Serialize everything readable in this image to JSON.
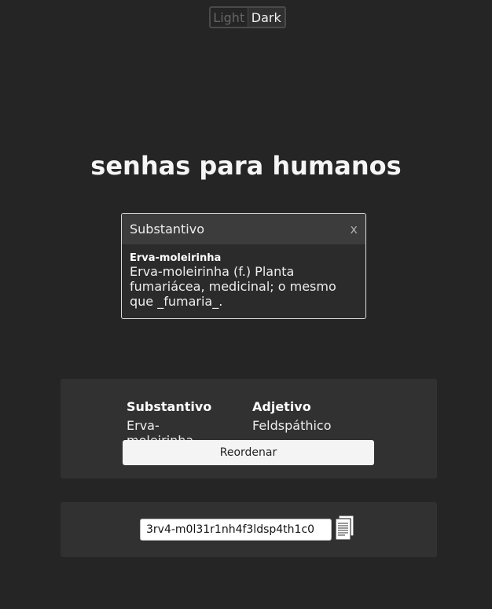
{
  "theme": {
    "light_label": "Light",
    "dark_label": "Dark",
    "selected": "Dark"
  },
  "header": {
    "title": "senhas para humanos"
  },
  "popup": {
    "title": "Substantivo",
    "close_label": "x",
    "word": "Erva-moleirinha",
    "definition": "Erva-moleirinha (f.) Planta fumariácea, medicinal; o mesmo que _fumaria_."
  },
  "words_panel": {
    "noun": {
      "heading": "Substantivo",
      "word": "Erva-moleirinha"
    },
    "adjective": {
      "heading": "Adjetivo",
      "word": "Feldspáthico"
    },
    "reorder_label": "Reordenar"
  },
  "password_panel": {
    "value": "3rv4-m0l31r1nh4f3ldsp4th1c0",
    "copy_icon": "copy-document-icon"
  }
}
